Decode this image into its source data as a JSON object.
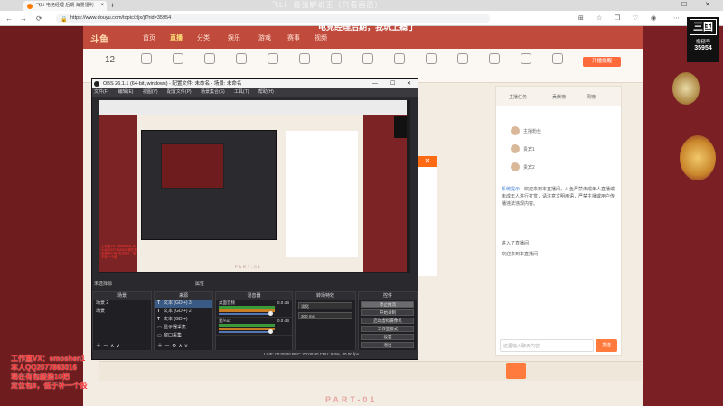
{
  "browser": {
    "tab_title": "飞Lⅰ-电竞经理 后期 海量福利",
    "url": "https://www.douyu.com/topic/zljx/jf?rid=35954",
    "back": "←",
    "forward": "→",
    "reload": "⟳",
    "newtab": "+",
    "tab_close": "×",
    "minimize": "—",
    "maximize": "☐",
    "close": "✕"
  },
  "overlay": {
    "top_text": "飞Lⅰ- 最强解说王（只看画面）",
    "title": "电竞经理后期，我玩上瘾了"
  },
  "site": {
    "logo": "斗鱼",
    "nav": [
      "首页",
      "直播",
      "分类",
      "娱乐",
      "游戏",
      "赛事",
      "视频"
    ],
    "active_nav": 1,
    "count": "12",
    "tools": [
      "",
      "",
      "",
      "",
      "",
      "",
      "",
      "",
      "",
      "",
      "",
      "",
      "",
      "",
      "",
      "",
      "",
      ""
    ],
    "tip_button": "开播提醒"
  },
  "obs": {
    "title": "OBS 26.1.1 (64-bit, windows) - 配置文件: 未命名 - 场景: 未命名",
    "menu": [
      "文件(F)",
      "编辑(E)",
      "视图(V)",
      "配置文件(P)",
      "场景集合(S)",
      "工具(T)",
      "帮助(H)"
    ],
    "no_scene": "未选择源",
    "mode": "属性",
    "scenes": {
      "header": "场景",
      "items": [
        "场景 2",
        "场景"
      ]
    },
    "sources": {
      "header": "来源",
      "items": [
        "文本 (GDI+) 3",
        "文本 (GDI+) 2",
        "文本 (GDI+)",
        "显示器采集",
        "窗口采集"
      ]
    },
    "mixer": {
      "header": "混音器",
      "channels": [
        {
          "name": "桌面音频",
          "db": "0.0 dB"
        },
        {
          "name": "麦/Aux",
          "db": "0.0 dB"
        }
      ]
    },
    "transitions": {
      "header": "转场特效",
      "type": "淡化",
      "duration": "300 ms"
    },
    "controls": {
      "header": "控件",
      "buttons": [
        "停止推流",
        "开始录制",
        "启动虚拟摄像机",
        "工作室模式",
        "设置",
        "退出"
      ]
    },
    "status": "LIVE: 00:00:00   REC: 00:00:00   CPU: 5.0%, 30.00 fps"
  },
  "chat": {
    "tabs": [
      "主播任务",
      "贡献榜",
      "周榜"
    ],
    "ranks": [
      "主播粉丝",
      "贵宾1",
      "贵宾2"
    ],
    "messages": [
      {
        "user": "系统提示：",
        "text": "欢迎来到本直播间，斗鱼严禁未成年人直播或未成年人进行打赏，请注意文明用语，严禁主播或用户传播违法违规内容。"
      },
      {
        "user": "",
        "text": "进入了直播间"
      },
      {
        "user": "",
        "text": "欢迎来到本直播间"
      }
    ],
    "input_placeholder": "这里输入聊天内容",
    "send": "发送"
  },
  "brand": {
    "logo": "三国",
    "sub": "视频号",
    "room": "35954"
  },
  "caption_red": [
    "工作室VX：emoshen1",
    "本人QQ2077863016",
    "现在有包毅扬10把",
    "定位包8，低于补一个段"
  ],
  "part_label": "PART-01",
  "nested_part_label": "PART-01",
  "nested_red_text": "工作室VX: emoshen1 本人QQ2077863016 现在有包毅扬10把 定位包8，低于补一个段",
  "popup_close": "✕"
}
